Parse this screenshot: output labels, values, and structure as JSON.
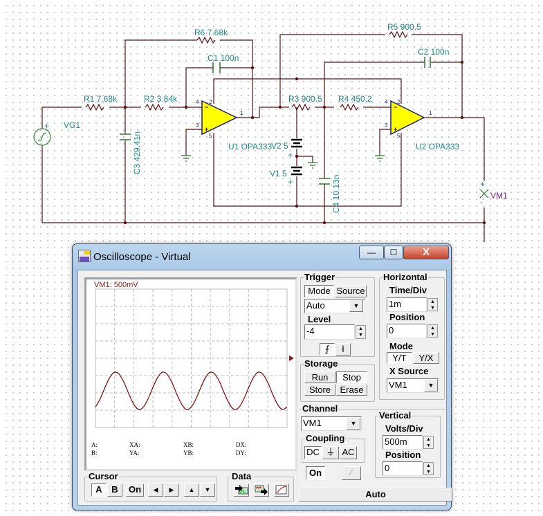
{
  "schematic": {
    "components": {
      "R1": "R1 7.68k",
      "R2": "R2 3.84k",
      "R3": "R3 900.5",
      "R4": "R4 450.2",
      "R5": "R5 900.5",
      "R6": "R6 7.68k",
      "C1": "C1 100n",
      "C2": "C2 100n",
      "C3": "C3 429.41n",
      "C4": "C4 10.13n",
      "VG1": "VG1",
      "V1": "V1 5",
      "V2": "V2 5",
      "U1": "U1 OPA333",
      "U2": "U2 OPA333",
      "VM1": "VM1"
    },
    "pins": {
      "p1": "1",
      "p2": "2",
      "p3": "3",
      "p4": "4",
      "p5": "5"
    },
    "colors": {
      "wire": "#5a1010",
      "label": "#1e8a8a",
      "opamp_fill": "#ffff00",
      "meter_label": "#8a1a8a"
    }
  },
  "window": {
    "title": "Oscilloscope - Virtual",
    "minimize": "—",
    "maximize": "☐",
    "close": "X"
  },
  "display": {
    "channel_label": "VM1: 500mV",
    "readouts": {
      "a": "A:",
      "b": "B:",
      "xa": "XA:",
      "ya": "YA:",
      "xb": "XB:",
      "yb": "YB:",
      "dx": "DX:",
      "dy": "DY:"
    }
  },
  "cursor": {
    "title": "Cursor",
    "a": "A",
    "b": "B",
    "on": "On",
    "left": "◀",
    "right": "▶",
    "up": "▲",
    "down": "▼"
  },
  "data": {
    "title": "Data"
  },
  "trigger": {
    "title": "Trigger",
    "mode_tab": "Mode",
    "source_tab": "Source",
    "mode_value": "Auto",
    "level_label": "Level",
    "level_value": "-4",
    "rising": "⨍",
    "falling": "ł"
  },
  "storage": {
    "title": "Storage",
    "run": "Run",
    "stop": "Stop",
    "store": "Store",
    "erase": "Erase"
  },
  "horizontal": {
    "title": "Horizontal",
    "time_div_label": "Time/Div",
    "time_div_value": "1m",
    "position_label": "Position",
    "position_value": "0",
    "mode_label": "Mode",
    "yt": "Y/T",
    "yx": "Y/X",
    "xsource_label": "X Source",
    "xsource_value": "VM1"
  },
  "channel": {
    "title": "Channel",
    "value": "VM1",
    "coupling_title": "Coupling",
    "dc": "DC",
    "gnd": "⏚",
    "ac": "AC",
    "on": "On"
  },
  "vertical": {
    "title": "Vertical",
    "volts_div_label": "Volts/Div",
    "volts_div_value": "500m",
    "position_label": "Position",
    "position_value": "0"
  },
  "status": "Auto",
  "chart_data": {
    "type": "line",
    "title": "VM1: 500mV",
    "x_unit": "ms",
    "y_unit": "V",
    "time_per_div": "1m",
    "volts_per_div": "500m",
    "xlim": [
      0,
      10
    ],
    "ylim": [
      -2,
      2
    ],
    "grid": true,
    "color": "#800000",
    "series": [
      {
        "name": "VM1",
        "x": [
          0,
          0.25,
          0.5,
          0.75,
          1,
          1.25,
          1.5,
          1.75,
          2,
          2.25,
          2.5,
          2.75,
          3,
          3.25,
          3.5,
          3.75,
          4,
          4.25,
          4.5,
          4.75,
          5,
          5.25,
          5.5,
          5.75,
          6,
          6.25,
          6.5,
          6.75,
          7,
          7.25,
          7.5,
          7.75,
          8,
          8.25,
          8.5,
          8.75,
          9,
          9.25,
          9.5,
          9.75,
          10
        ],
        "y": [
          -1.41,
          -1.17,
          -0.84,
          -0.55,
          -0.4,
          -0.47,
          -0.71,
          -1.04,
          -1.33,
          -1.48,
          -1.41,
          -1.17,
          -0.84,
          -0.55,
          -0.4,
          -0.47,
          -0.71,
          -1.04,
          -1.33,
          -1.48,
          -1.41,
          -1.17,
          -0.84,
          -0.55,
          -0.4,
          -0.47,
          -0.71,
          -1.04,
          -1.33,
          -1.48,
          -1.41,
          -1.17,
          -0.84,
          -0.55,
          -0.4,
          -0.47,
          -0.71,
          -1.04,
          -1.33,
          -1.48,
          -1.41
        ]
      }
    ]
  }
}
